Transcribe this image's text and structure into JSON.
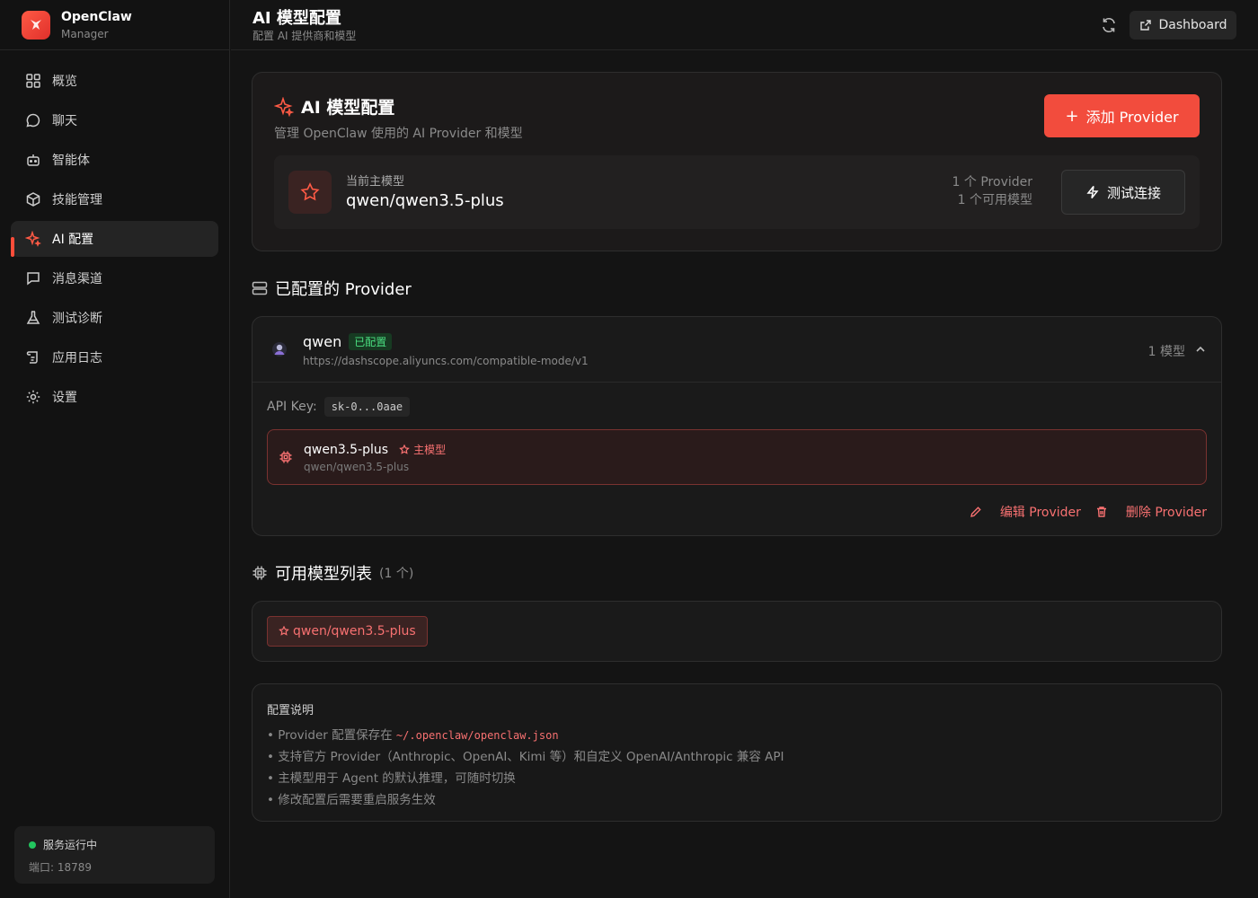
{
  "brand": {
    "title": "OpenClaw",
    "subtitle": "Manager"
  },
  "nav": {
    "items": [
      {
        "label": "概览",
        "icon": "grid-icon"
      },
      {
        "label": "聊天",
        "icon": "chat-icon"
      },
      {
        "label": "智能体",
        "icon": "bot-icon"
      },
      {
        "label": "技能管理",
        "icon": "package-icon"
      },
      {
        "label": "AI 配置",
        "icon": "sparkle-icon",
        "active": true
      },
      {
        "label": "消息渠道",
        "icon": "message-square-icon"
      },
      {
        "label": "测试诊断",
        "icon": "flask-icon"
      },
      {
        "label": "应用日志",
        "icon": "scroll-icon"
      },
      {
        "label": "设置",
        "icon": "gear-icon"
      }
    ]
  },
  "status": {
    "text": "服务运行中",
    "port": "端口: 18789"
  },
  "header": {
    "title": "AI 模型配置",
    "subtitle": "配置 AI 提供商和模型",
    "dashboard_label": "Dashboard"
  },
  "hero": {
    "title": "AI 模型配置",
    "subtitle": "管理 OpenClaw 使用的 AI Provider 和模型",
    "add_label": "添加 Provider",
    "current_label": "当前主模型",
    "current_model": "qwen/qwen3.5-plus",
    "provider_count": "1 个 Provider",
    "model_count": "1 个可用模型",
    "test_label": "测试连接"
  },
  "providers_section": {
    "title": "已配置的 Provider"
  },
  "provider": {
    "name": "qwen",
    "badge": "已配置",
    "url": "https://dashscope.aliyuncs.com/compatible-mode/v1",
    "model_count": "1 模型",
    "api_key_label": "API Key:",
    "api_key_value": "sk-0...0aae",
    "model_name": "qwen3.5-plus",
    "main_badge": "主模型",
    "model_id": "qwen/qwen3.5-plus",
    "edit_label": "编辑 Provider",
    "delete_label": "删除 Provider"
  },
  "models_section": {
    "title": "可用模型列表",
    "count": "(1 个)",
    "chip": "qwen/qwen3.5-plus"
  },
  "info": {
    "title": "配置说明",
    "line1_prefix": "• Provider 配置保存在 ",
    "line1_path": "~/.openclaw/openclaw.json",
    "line2": "• 支持官方 Provider（Anthropic、OpenAI、Kimi 等）和自定义 OpenAI/Anthropic 兼容 API",
    "line3": "• 主模型用于 Agent 的默认推理，可随时切换",
    "line4": "• 修改配置后需要重启服务生效"
  },
  "colors": {
    "accent": "#f24c3d",
    "success": "#22c55e",
    "background": "#141414"
  }
}
